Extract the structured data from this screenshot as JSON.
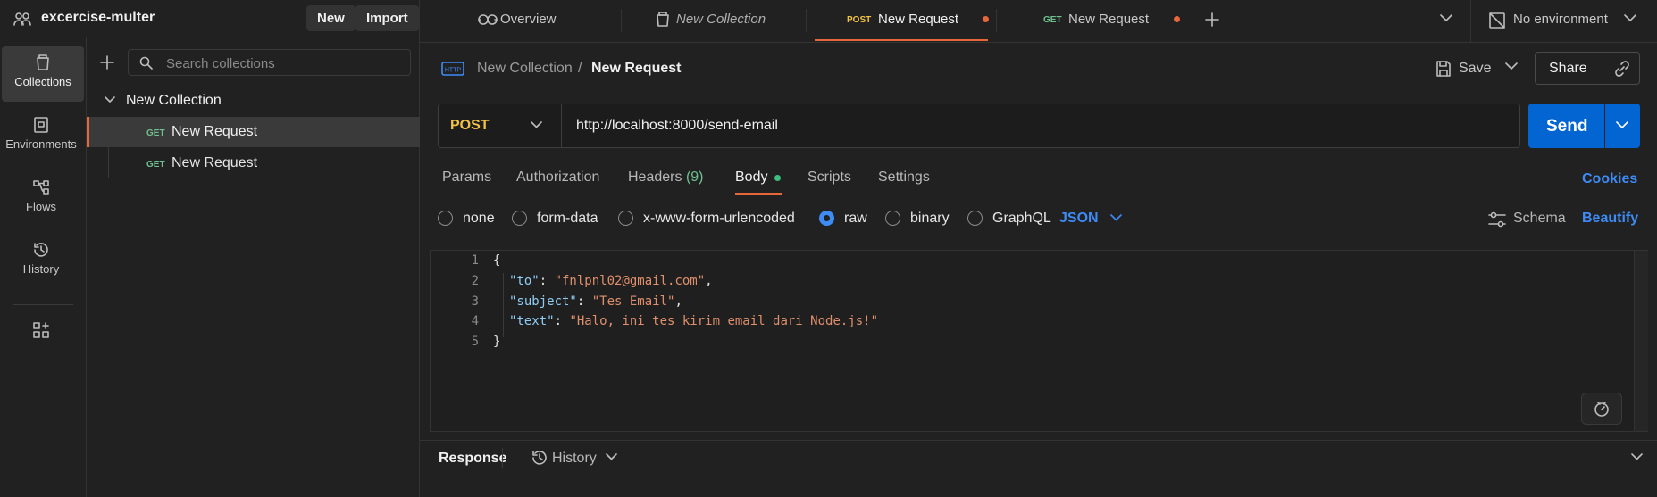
{
  "workspace": {
    "name": "excercise-multer",
    "new_label": "New",
    "import_label": "Import"
  },
  "rail": {
    "collections": "Collections",
    "environments": "Environments",
    "flows": "Flows",
    "history": "History"
  },
  "sidebar": {
    "search_placeholder": "Search collections",
    "collection": {
      "name": "New Collection",
      "requests": [
        {
          "method": "GET",
          "name": "New Request"
        },
        {
          "method": "GET",
          "name": "New Request"
        }
      ]
    }
  },
  "tabs": {
    "overview": "Overview",
    "collection": "New Collection",
    "post_method": "POST",
    "post_label": "New Request",
    "get_method": "GET",
    "get_label": "New Request",
    "environment": "No environment"
  },
  "breadcrumb": {
    "collection": "New Collection",
    "separator": "/",
    "request": "New Request"
  },
  "toolbar": {
    "save": "Save",
    "share": "Share"
  },
  "request": {
    "method": "POST",
    "url": "http://localhost:8000/send-email",
    "send": "Send"
  },
  "request_tabs": {
    "params": "Params",
    "authorization": "Authorization",
    "headers": "Headers",
    "headers_count": "(9)",
    "body": "Body",
    "scripts": "Scripts",
    "settings": "Settings",
    "cookies": "Cookies"
  },
  "body_types": {
    "none": "none",
    "form_data": "form-data",
    "urlencoded": "x-www-form-urlencoded",
    "raw": "raw",
    "binary": "binary",
    "graphql": "GraphQL",
    "selected": "raw",
    "language": "JSON",
    "schema": "Schema",
    "beautify": "Beautify"
  },
  "editor": {
    "line_numbers": [
      "1",
      "2",
      "3",
      "4",
      "5"
    ],
    "open_brace": "{",
    "close_brace": "}",
    "lines": [
      {
        "key": "\"to\"",
        "value": "\"fnlpnl02@gmail.com\"",
        "trail": ","
      },
      {
        "key": "\"subject\"",
        "value": "\"Tes Email\"",
        "trail": ","
      },
      {
        "key": "\"text\"",
        "value": "\"Halo, ini tes kirim email dari Node.js!\"",
        "trail": ""
      }
    ]
  },
  "response": {
    "label": "Response",
    "history": "History"
  },
  "colors": {
    "accent": "#e8673a",
    "primary": "#0265d2",
    "link": "#3e8bf6",
    "post": "#f1c243",
    "get": "#6fc18f"
  }
}
